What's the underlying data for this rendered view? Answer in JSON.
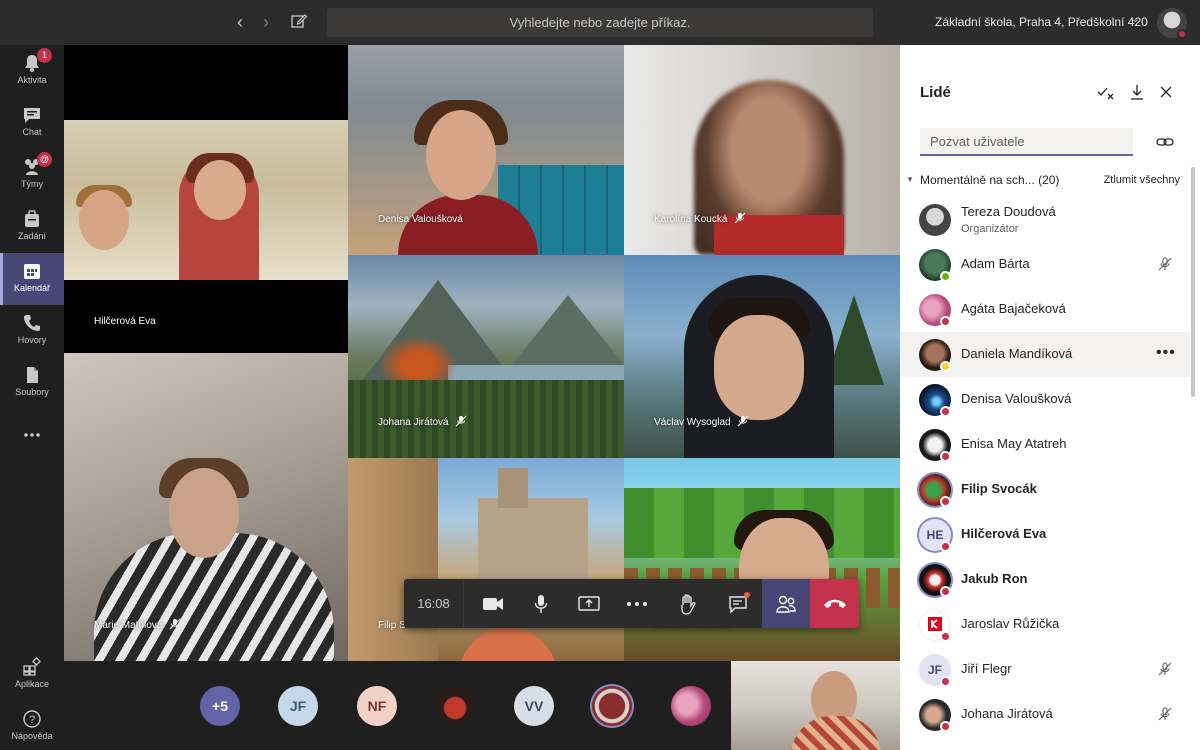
{
  "topbar": {
    "search_placeholder": "Vyhledejte nebo zadejte příkaz.",
    "org_name": "Základní škola, Praha 4, Předškolní 420"
  },
  "rail": {
    "items": [
      {
        "label": "Aktivita",
        "icon": "bell-icon",
        "badge": "1"
      },
      {
        "label": "Chat",
        "icon": "chat-icon"
      },
      {
        "label": "Týmy",
        "icon": "teams-icon",
        "badge": "@"
      },
      {
        "label": "Zadání",
        "icon": "assignments-icon"
      },
      {
        "label": "Kalendář",
        "icon": "calendar-icon",
        "active": true
      },
      {
        "label": "Hovory",
        "icon": "phone-icon"
      },
      {
        "label": "Soubory",
        "icon": "files-icon"
      },
      {
        "label": "…",
        "icon": "more-icon"
      }
    ],
    "bottom": [
      {
        "label": "Aplikace",
        "icon": "apps-icon"
      },
      {
        "label": "Nápověda",
        "icon": "help-icon"
      }
    ]
  },
  "tiles": {
    "hilcerova": "Hilčerová Eva",
    "marie": "Marie Matulová",
    "denisa": "Denisa Valoušková",
    "karolina": "Karolína Koucká",
    "johana": "Johana Jirátová",
    "vaclav": "Václav Wysoglad",
    "filip": "Filip Svocák",
    "jaroslav": "Jaroslav Růžička"
  },
  "controls": {
    "timer": "16:08"
  },
  "strip": {
    "overflow": "+5",
    "initials": [
      "JF",
      "NF",
      "VV"
    ]
  },
  "panel": {
    "title": "Lidé",
    "invite_placeholder": "Pozvat uživatele",
    "section_title": "Momentálně na sch...",
    "section_count": "(20)",
    "mute_all": "Ztlumit všechny",
    "people": [
      {
        "name": "Tereza Doudová",
        "role": "Organizátor"
      },
      {
        "name": "Adam Bárta"
      },
      {
        "name": "Agáta Bajačeková"
      },
      {
        "name": "Daniela Mandíková"
      },
      {
        "name": "Denisa Valoušková"
      },
      {
        "name": "Enisa May Atatreh"
      },
      {
        "name": "Filip Svocák"
      },
      {
        "name": "Hilčerová Eva",
        "initials": "HE"
      },
      {
        "name": "Jakub Ron"
      },
      {
        "name": "Jaroslav Růžička"
      },
      {
        "name": "Jiří Flegr",
        "initials": "JF"
      },
      {
        "name": "Johana Jirátová"
      }
    ]
  },
  "colors": {
    "accent": "#6264a7",
    "rail_active": "#464775",
    "hangup": "#c4314b",
    "status_busy": "#c4314b",
    "status_available": "#6bb700"
  }
}
